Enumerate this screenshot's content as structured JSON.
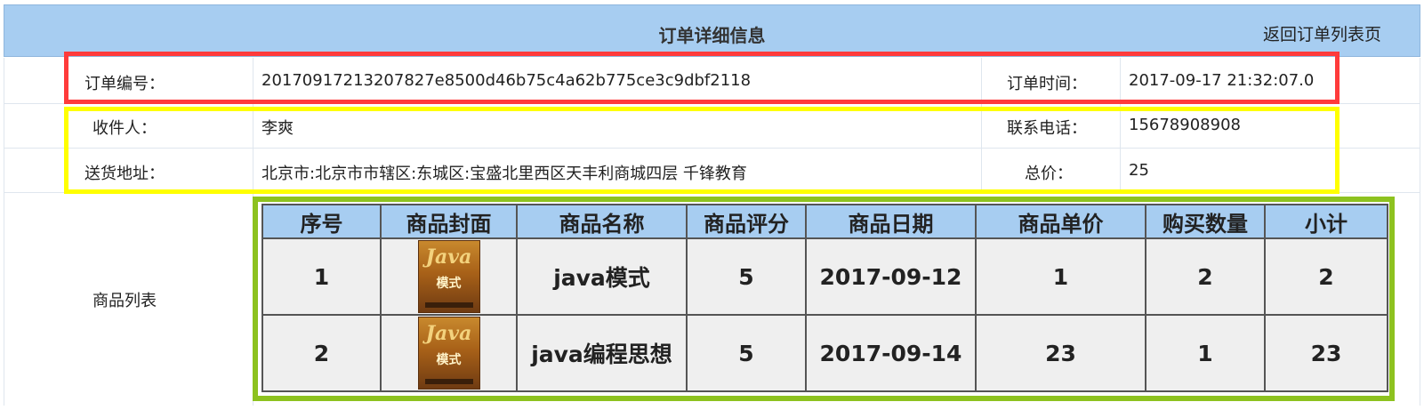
{
  "header": {
    "title": "订单详细信息",
    "back_link": "返回订单列表页"
  },
  "order": {
    "id_label": "订单编号：",
    "id_value": "20170917213207827e8500d46b75c4a62b775ce3c9dbf2118",
    "time_label": "订单时间：",
    "time_value": "2017-09-17 21:32:07.0",
    "receiver_label": "收件人：",
    "receiver_value": "李爽",
    "phone_label": "联系电话：",
    "phone_value": "15678908908",
    "address_label": "送货地址：",
    "address_value": "北京市:北京市市辖区:东城区:宝盛北里西区天丰利商城四层 千锋教育",
    "total_label": "总价：",
    "total_value": "25",
    "products_label": "商品列表"
  },
  "highlight_colors": {
    "order_id_box": "#ff3b3b",
    "receiver_box": "#ffff00",
    "products_box": "#8dc21f"
  },
  "products": {
    "columns": [
      "序号",
      "商品封面",
      "商品名称",
      "商品评分",
      "商品日期",
      "商品单价",
      "购买数量",
      "小计"
    ],
    "rows": [
      {
        "no": "1",
        "cover_icon": "book-cover-image",
        "cover_title": "Java",
        "cover_subtitle": "模式",
        "name": "java模式",
        "rating": "5",
        "date": "2017-09-12",
        "price": "1",
        "qty": "2",
        "subtotal": "2"
      },
      {
        "no": "2",
        "cover_icon": "book-cover-image",
        "cover_title": "Java",
        "cover_subtitle": "模式",
        "name": "java编程思想",
        "rating": "5",
        "date": "2017-09-14",
        "price": "23",
        "qty": "1",
        "subtotal": "23"
      }
    ]
  }
}
